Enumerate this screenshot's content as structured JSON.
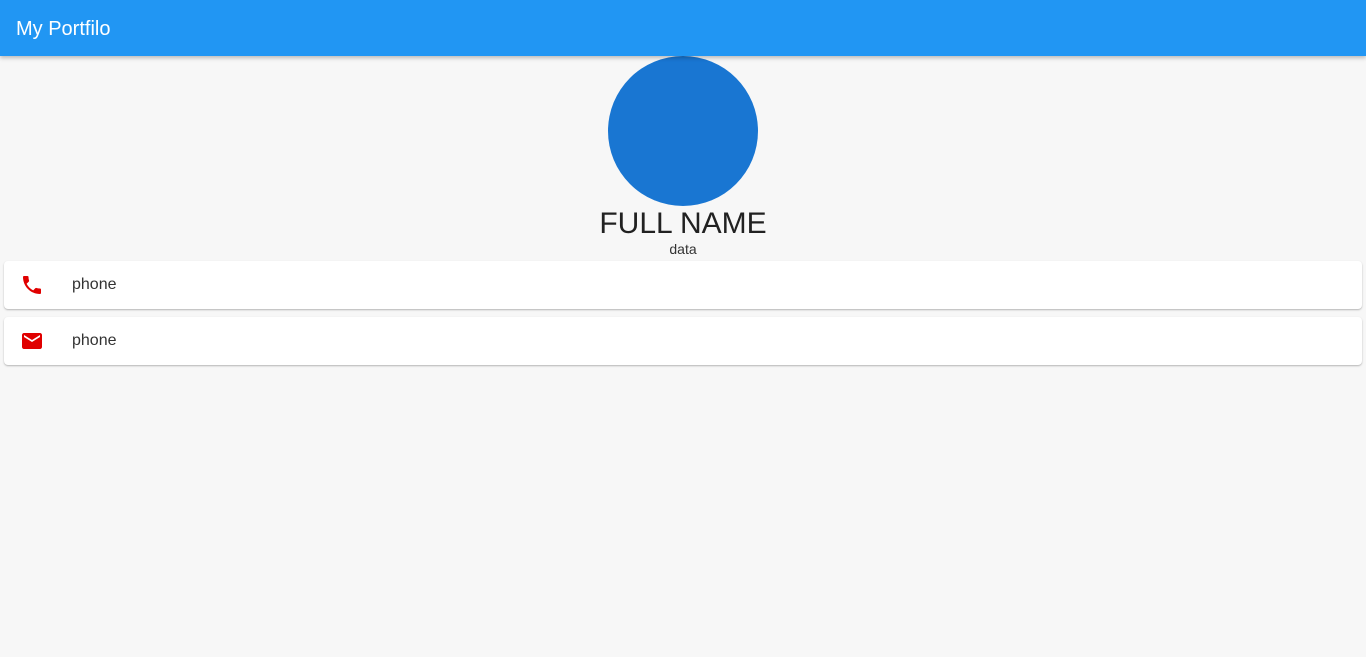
{
  "appbar": {
    "title": "My Portfilo",
    "color": "#2196f3"
  },
  "profile": {
    "avatar_color": "#1976d2",
    "full_name": "FULL NAME",
    "subtitle": "data"
  },
  "contacts": [
    {
      "icon": "phone-icon",
      "label": "phone",
      "icon_color": "#e00000"
    },
    {
      "icon": "email-icon",
      "label": "phone",
      "icon_color": "#e00000"
    }
  ]
}
